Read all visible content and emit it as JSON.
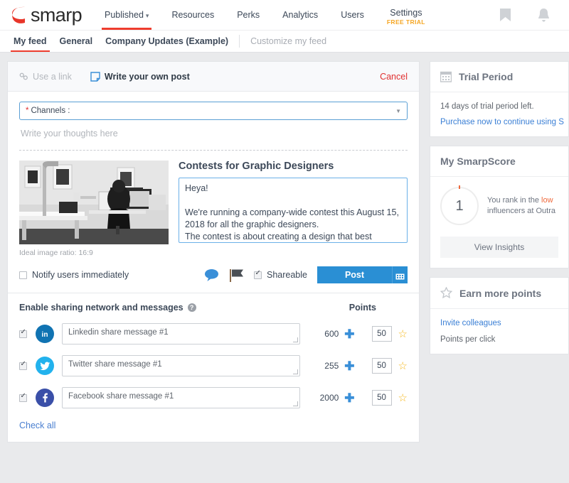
{
  "brand": {
    "logo_text": "smarp",
    "logo_color": "#e8362a"
  },
  "topnav": {
    "items": [
      {
        "label": "Published",
        "caret": "chevron-down-icon",
        "active": true
      },
      {
        "label": "Resources"
      },
      {
        "label": "Perks"
      },
      {
        "label": "Analytics"
      },
      {
        "label": "Users"
      },
      {
        "label": "Settings",
        "sub": "FREE TRIAL"
      }
    ],
    "icons": [
      "bookmark-icon",
      "bell-icon"
    ]
  },
  "tabs": [
    {
      "label": "My feed",
      "active": true
    },
    {
      "label": "General",
      "active": false
    },
    {
      "label": "Company Updates (Example)",
      "active": false
    },
    {
      "label": "Customize my feed",
      "muted": true
    }
  ],
  "composer": {
    "use_link": "Use a link",
    "write_post": "Write your own post",
    "cancel": "Cancel",
    "channels_label": "Channels :",
    "channels_required": "*",
    "thoughts_placeholder": "Write your thoughts here",
    "preview": {
      "title": "Contests for Graphic Designers",
      "ratio_hint": "Ideal image ratio: 16:9",
      "body": "Heya!\n\nWe're running a company-wide contest this August 15, 2018 for all the graphic designers.\nThe contest is about creating a design that best"
    },
    "notify_label": "Notify users immediately",
    "notify_checked": false,
    "shareable_label": "Shareable",
    "shareable_checked": true,
    "post_label": "Post",
    "icons": {
      "comment": "comment-icon",
      "flag": "flag-icon",
      "calendar": "calendar-icon"
    }
  },
  "sharing": {
    "heading": "Enable sharing network and messages",
    "points_header": "Points",
    "check_all": "Check all",
    "rows": [
      {
        "network": "linkedin",
        "checked": true,
        "message": "Linkedin share message #1",
        "count": "600",
        "points": "50",
        "color": "#1073b2",
        "glyph": "in"
      },
      {
        "network": "twitter",
        "checked": true,
        "message": "Twitter share message #1",
        "count": "255",
        "points": "50",
        "color": "#22b2ed",
        "glyph": "t"
      },
      {
        "network": "facebook",
        "checked": true,
        "message": "Facebook share message #1",
        "count": "2000",
        "points": "50",
        "color": "#3a4fa8",
        "glyph": "f"
      }
    ]
  },
  "sidebar": {
    "trial": {
      "title": "Trial Period",
      "days_text": "14 days of trial period left.",
      "purchase_link": "Purchase now to continue using S"
    },
    "smarpscore": {
      "title": "My SmarpScore",
      "score": "1",
      "rank_prefix": "You rank in the ",
      "rank_highlight": "low",
      "rank_line2": "influencers at Outra",
      "view_insights": "View Insights"
    },
    "earn": {
      "title": "Earn more points",
      "invite": "Invite colleagues",
      "per_click": "Points per click"
    }
  }
}
